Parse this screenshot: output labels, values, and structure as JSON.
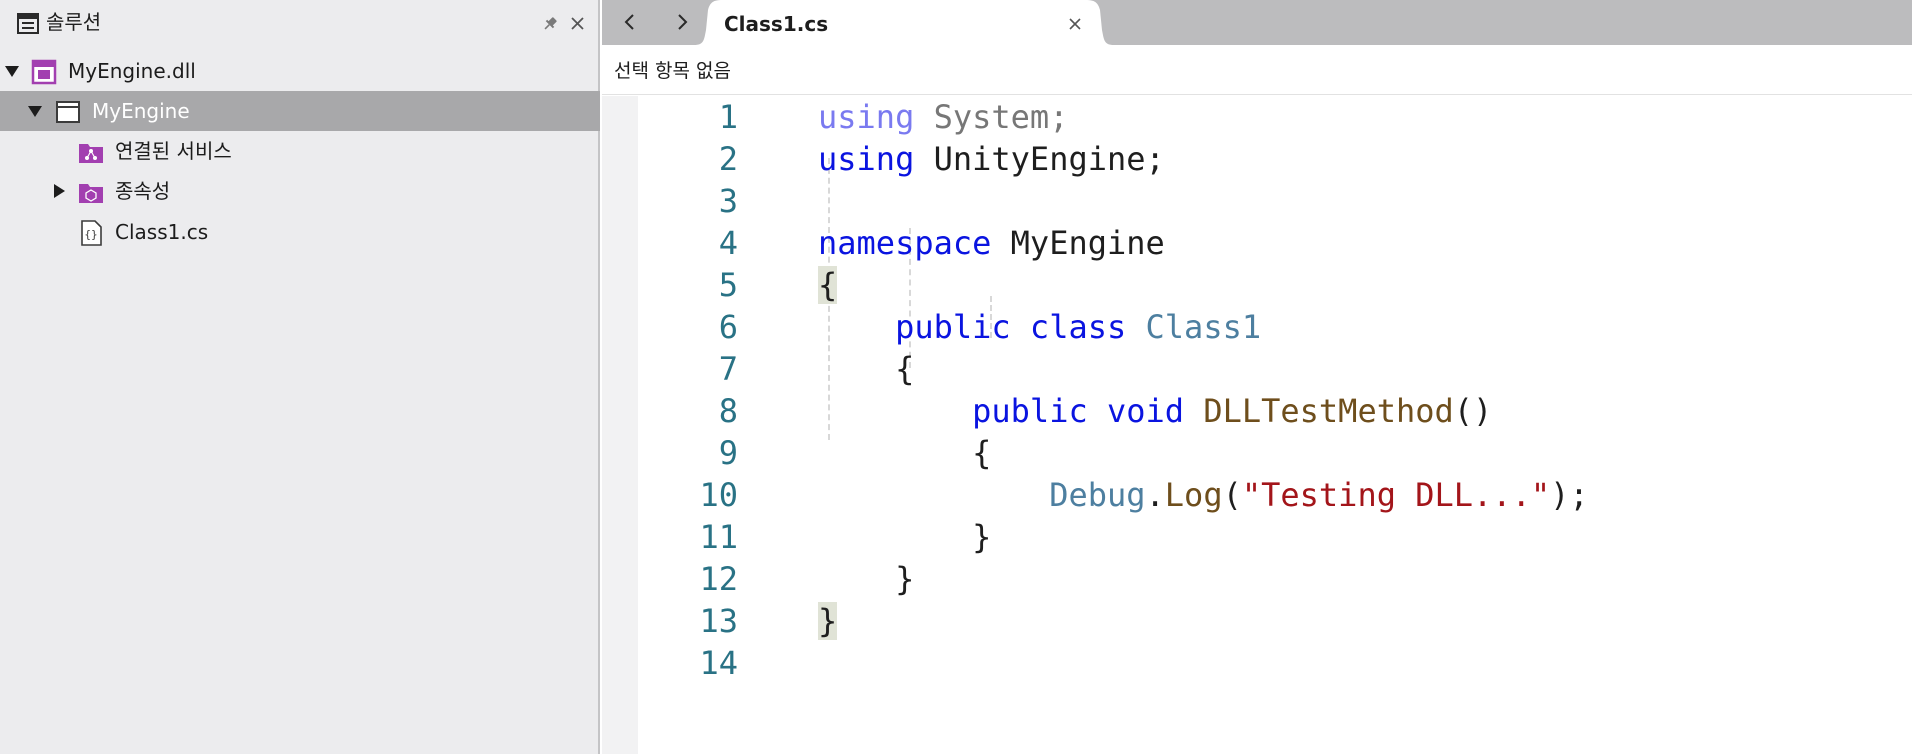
{
  "solution_pane": {
    "title": "솔루션",
    "tree": [
      {
        "label": "MyEngine.dll",
        "expanded": true,
        "icon": "assembly-icon"
      },
      {
        "label": "MyEngine",
        "expanded": true,
        "selected": true,
        "icon": "project-icon"
      },
      {
        "label": "연결된 서비스",
        "icon": "connected-services-icon"
      },
      {
        "label": "종속성",
        "expanded": false,
        "icon": "dependencies-icon"
      },
      {
        "label": "Class1.cs",
        "icon": "csharp-file-icon"
      }
    ]
  },
  "editor": {
    "tab": {
      "label": "Class1.cs"
    },
    "breadcrumb": "선택 항목 없음",
    "line_numbers": [
      "1",
      "2",
      "3",
      "4",
      "5",
      "6",
      "7",
      "8",
      "9",
      "10",
      "11",
      "12",
      "13",
      "14"
    ],
    "code": {
      "l1_kw": "using",
      "l1_rest": " System;",
      "l2_kw": "using",
      "l2_rest": " UnityEngine;",
      "l4_kw": "namespace",
      "l4_rest": " MyEngine",
      "l5_brace": "{",
      "l6_kw1": "public",
      "l6_kw2": "class",
      "l6_type": "Class1",
      "l7_brace": "{",
      "l8_kw1": "public",
      "l8_kw2": "void",
      "l8_method": "DLLTestMethod",
      "l8_parens": "()",
      "l9_brace": "{",
      "l10_type": "Debug",
      "l10_dot": ".",
      "l10_method": "Log",
      "l10_open": "(",
      "l10_str": "\"Testing DLL...\"",
      "l10_close": ");",
      "l11_brace": "}",
      "l12_brace": "}",
      "l13_brace": "}"
    }
  },
  "colors": {
    "keyword": "#0a14e0",
    "type": "#4d7fa0",
    "method": "#6e4e1c",
    "string": "#a3151a",
    "line_number": "#297285",
    "selection": "#a8a8aa",
    "tab_bar": "#bcbcbe",
    "sidebar": "#ececee"
  }
}
